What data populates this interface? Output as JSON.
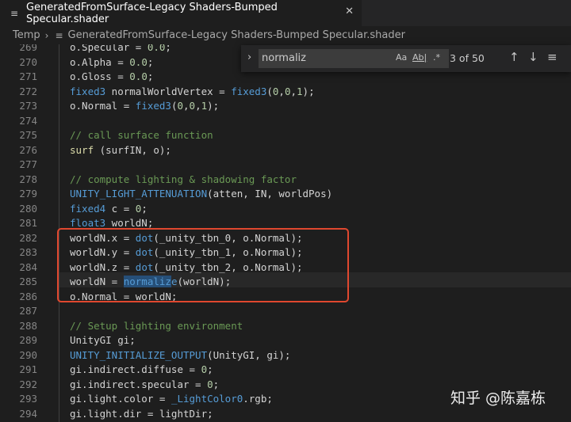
{
  "tab": {
    "file_icon": "≡",
    "title": "GeneratedFromSurface-Legacy Shaders-Bumped Specular.shader",
    "close_icon": "✕"
  },
  "breadcrumb": {
    "folder": "Temp",
    "sep": "›",
    "file_icon": "≡",
    "file": "GeneratedFromSurface-Legacy Shaders-Bumped Specular.shader"
  },
  "find": {
    "toggle_icon": "›",
    "query": "normaliz",
    "match_case": "Aa",
    "whole_word": "Ab|",
    "regex": ".*",
    "count": "3 of 50",
    "prev_icon": "↑",
    "next_icon": "↓",
    "selection_icon": "≡"
  },
  "code_lines": [
    {
      "n": "269",
      "tokens": [
        {
          "t": "o.Specular = ",
          "c": ""
        },
        {
          "t": "0.0",
          "c": "num"
        },
        {
          "t": ";",
          "c": ""
        }
      ]
    },
    {
      "n": "270",
      "tokens": [
        {
          "t": "o.Alpha = ",
          "c": ""
        },
        {
          "t": "0.0",
          "c": "num"
        },
        {
          "t": ";",
          "c": ""
        }
      ]
    },
    {
      "n": "271",
      "tokens": [
        {
          "t": "o.Gloss = ",
          "c": ""
        },
        {
          "t": "0.0",
          "c": "num"
        },
        {
          "t": ";",
          "c": ""
        }
      ]
    },
    {
      "n": "272",
      "tokens": [
        {
          "t": "fixed3",
          "c": "kw"
        },
        {
          "t": " normalWorldVertex = ",
          "c": ""
        },
        {
          "t": "fixed3",
          "c": "kw"
        },
        {
          "t": "(",
          "c": ""
        },
        {
          "t": "0",
          "c": "num"
        },
        {
          "t": ",",
          "c": ""
        },
        {
          "t": "0",
          "c": "num"
        },
        {
          "t": ",",
          "c": ""
        },
        {
          "t": "1",
          "c": "num"
        },
        {
          "t": ");",
          "c": ""
        }
      ]
    },
    {
      "n": "273",
      "tokens": [
        {
          "t": "o.Normal = ",
          "c": ""
        },
        {
          "t": "fixed3",
          "c": "kw"
        },
        {
          "t": "(",
          "c": ""
        },
        {
          "t": "0",
          "c": "num"
        },
        {
          "t": ",",
          "c": ""
        },
        {
          "t": "0",
          "c": "num"
        },
        {
          "t": ",",
          "c": ""
        },
        {
          "t": "1",
          "c": "num"
        },
        {
          "t": ");",
          "c": ""
        }
      ]
    },
    {
      "n": "274",
      "tokens": []
    },
    {
      "n": "275",
      "tokens": [
        {
          "t": "// call surface function",
          "c": "cm"
        }
      ]
    },
    {
      "n": "276",
      "tokens": [
        {
          "t": "surf",
          "c": "fn"
        },
        {
          "t": " (surfIN, o);",
          "c": ""
        }
      ]
    },
    {
      "n": "277",
      "tokens": []
    },
    {
      "n": "278",
      "tokens": [
        {
          "t": "// compute lighting & shadowing factor",
          "c": "cm"
        }
      ]
    },
    {
      "n": "279",
      "tokens": [
        {
          "t": "UNITY_LIGHT_ATTENUATION",
          "c": "kw"
        },
        {
          "t": "(atten, IN, worldPos)",
          "c": ""
        }
      ]
    },
    {
      "n": "280",
      "tokens": [
        {
          "t": "fixed4",
          "c": "kw"
        },
        {
          "t": " c = ",
          "c": ""
        },
        {
          "t": "0",
          "c": "num"
        },
        {
          "t": ";",
          "c": ""
        }
      ]
    },
    {
      "n": "281",
      "tokens": [
        {
          "t": "float3",
          "c": "kw"
        },
        {
          "t": " worldN;",
          "c": ""
        }
      ]
    },
    {
      "n": "282",
      "tokens": [
        {
          "t": "worldN.x = ",
          "c": ""
        },
        {
          "t": "dot",
          "c": "kw"
        },
        {
          "t": "(_unity_tbn_0, o.Normal);",
          "c": ""
        }
      ]
    },
    {
      "n": "283",
      "tokens": [
        {
          "t": "worldN.y = ",
          "c": ""
        },
        {
          "t": "dot",
          "c": "kw"
        },
        {
          "t": "(_unity_tbn_1, o.Normal);",
          "c": ""
        }
      ]
    },
    {
      "n": "284",
      "tokens": [
        {
          "t": "worldN.z = ",
          "c": ""
        },
        {
          "t": "dot",
          "c": "kw"
        },
        {
          "t": "(_unity_tbn_2, o.Normal);",
          "c": ""
        }
      ]
    },
    {
      "n": "285",
      "tokens": [
        {
          "t": "worldN = ",
          "c": ""
        },
        {
          "t": "normaliz",
          "c": "kw hl"
        },
        {
          "t": "e",
          "c": "kw"
        },
        {
          "t": "(worldN);",
          "c": ""
        }
      ]
    },
    {
      "n": "286",
      "tokens": [
        {
          "t": "o.Normal = worldN;",
          "c": ""
        }
      ]
    },
    {
      "n": "287",
      "tokens": []
    },
    {
      "n": "288",
      "tokens": [
        {
          "t": "// Setup lighting environment",
          "c": "cm"
        }
      ]
    },
    {
      "n": "289",
      "tokens": [
        {
          "t": "UnityGI gi;",
          "c": ""
        }
      ]
    },
    {
      "n": "290",
      "tokens": [
        {
          "t": "UNITY_INITIALIZE_OUTPUT",
          "c": "kw"
        },
        {
          "t": "(UnityGI, gi);",
          "c": ""
        }
      ]
    },
    {
      "n": "291",
      "tokens": [
        {
          "t": "gi.indirect.diffuse = ",
          "c": ""
        },
        {
          "t": "0",
          "c": "num"
        },
        {
          "t": ";",
          "c": ""
        }
      ]
    },
    {
      "n": "292",
      "tokens": [
        {
          "t": "gi.indirect.specular = ",
          "c": ""
        },
        {
          "t": "0",
          "c": "num"
        },
        {
          "t": ";",
          "c": ""
        }
      ]
    },
    {
      "n": "293",
      "tokens": [
        {
          "t": "gi.light.color = ",
          "c": ""
        },
        {
          "t": "_LightColor0",
          "c": "kw"
        },
        {
          "t": ".rgb;",
          "c": ""
        }
      ]
    },
    {
      "n": "294",
      "tokens": [
        {
          "t": "gi.light.dir = lightDir;",
          "c": ""
        }
      ]
    }
  ],
  "watermark": "知乎 @陈嘉栋",
  "colors": {
    "keyword": "#569cd6",
    "function": "#dcdcaa",
    "comment": "#6a9955",
    "number": "#b5cea8",
    "match_highlight": "#264f78",
    "annotation_box": "#e0482f"
  }
}
